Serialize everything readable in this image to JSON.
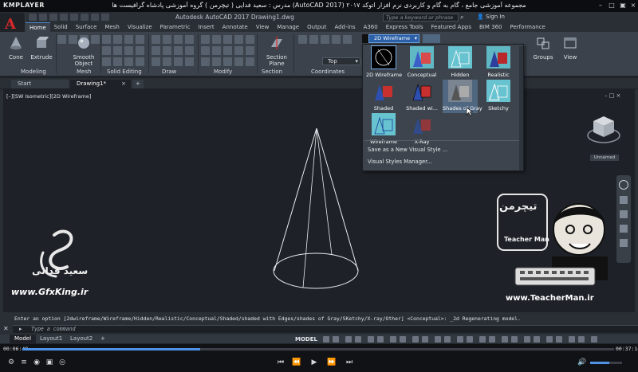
{
  "player": {
    "logo": "KMPLAYER",
    "title": "مجموعه آموزشی جامع ، گام به گام و کاربردی نرم افزار اتوکد ۲۰۱۷ (AutoCAD 2017) مدرس : سعید فدایی ( تیچرمن ) گروه آموزشی پادشاه گرافیست ها",
    "time_current": "00:06:48",
    "time_total": "00:37:16",
    "progress": 0.3,
    "volume": 0.6
  },
  "app": {
    "title": "Autodesk AutoCAD 2017   Drawing1.dwg",
    "search_placeholder": "Type a keyword or phrase",
    "signin": "Sign In"
  },
  "ribbon_tabs": [
    "Home",
    "Solid",
    "Surface",
    "Mesh",
    "Visualize",
    "Parametric",
    "Insert",
    "Annotate",
    "View",
    "Manage",
    "Output",
    "Add-ins",
    "A360",
    "Express Tools",
    "Featured Apps",
    "BIM 360",
    "Performance"
  ],
  "ribbon": {
    "tools": {
      "cone": "Cone",
      "extrude": "Extrude",
      "smooth": "Smooth Object",
      "section": "Section Plane",
      "groups": "Groups",
      "view": "View"
    },
    "panels": {
      "modeling": "Modeling",
      "mesh": "Mesh",
      "solid_editing": "Solid Editing",
      "draw": "Draw",
      "modify": "Modify",
      "section": "Section",
      "coordinates": "Coordinates"
    },
    "view_dropdown": "Top"
  },
  "file_tabs": {
    "start": "Start",
    "drawing": "Drawing1*",
    "add": "+"
  },
  "viewport": {
    "label": "[–][SW Isometric][2D Wireframe]",
    "unnamed": "Unnamed"
  },
  "visual_styles": {
    "current": "2D Wireframe",
    "items": [
      "2D Wireframe",
      "Conceptual",
      "Hidden",
      "Realistic",
      "Shaded",
      "Shaded wi...",
      "Shades of Gray",
      "Sketchy",
      "Wireframe",
      "X-Ray"
    ],
    "menu": [
      "Save as a New Visual Style ...",
      "Visual Styles Manager..."
    ]
  },
  "watermarks": {
    "gfx": "www.GfxKing.ir",
    "saeed": "سعید فدائی",
    "teacher": "www.TeacherMan.ir",
    "tm_fa": "تیچرمن",
    "tm_en": "Teacher Man"
  },
  "command": {
    "history": "Enter an option [2dwireframe/Wireframe/Hidden/Realistic/Conceptual/Shaded/shaded with Edges/shades of Gray/SKetchy/X-ray/Other] <Conceptual>: _2d Regenerating model.",
    "placeholder": "Type a command"
  },
  "layout_tabs": [
    "Model",
    "Layout1",
    "Layout2",
    "+"
  ],
  "status": {
    "model": "MODEL"
  },
  "colors": {
    "accent": "#4f93e6",
    "autocad_red": "#d8282a"
  }
}
